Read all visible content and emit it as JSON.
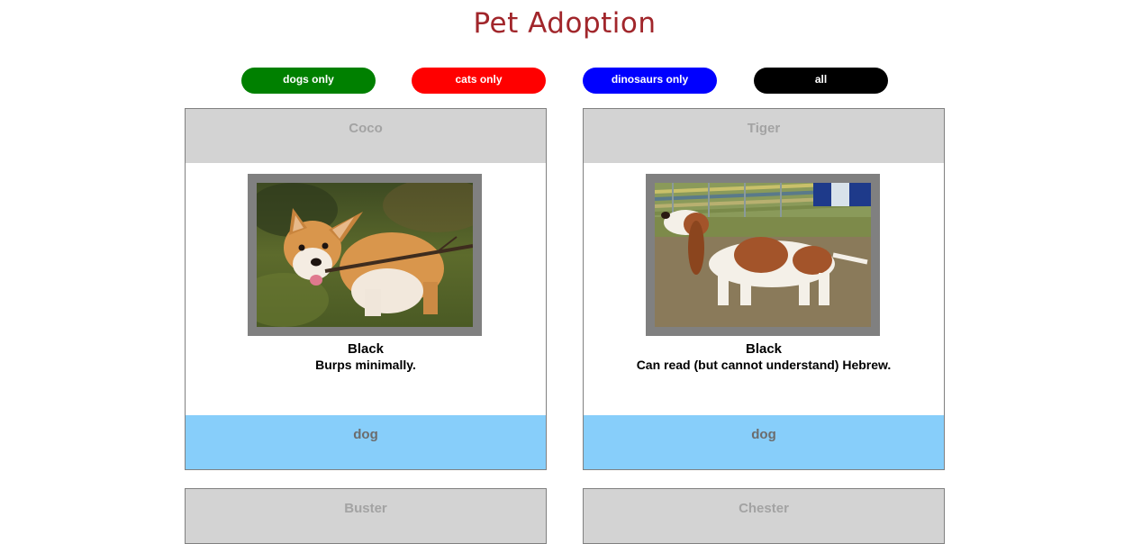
{
  "page_title": "Pet Adoption",
  "filters": {
    "dogs": "dogs only",
    "cats": "cats only",
    "dinosaurs": "dinosaurs only",
    "all": "all"
  },
  "colors": {
    "title": "#a1262b",
    "dogs_button": "#008000",
    "cats_button": "#ff0000",
    "dinosaurs_button": "#0000ff",
    "all_button": "#000000",
    "card_header": "#d3d3d3",
    "card_footer": "#87cefa"
  },
  "pets": [
    {
      "name": "Coco",
      "color": "Black",
      "description": "Burps minimally.",
      "type": "dog",
      "photo": "corgi-photo"
    },
    {
      "name": "Tiger",
      "color": "Black",
      "description": "Can read (but cannot understand) Hebrew.",
      "type": "dog",
      "photo": "basset-hound-photo"
    },
    {
      "name": "Buster"
    },
    {
      "name": "Chester"
    }
  ]
}
